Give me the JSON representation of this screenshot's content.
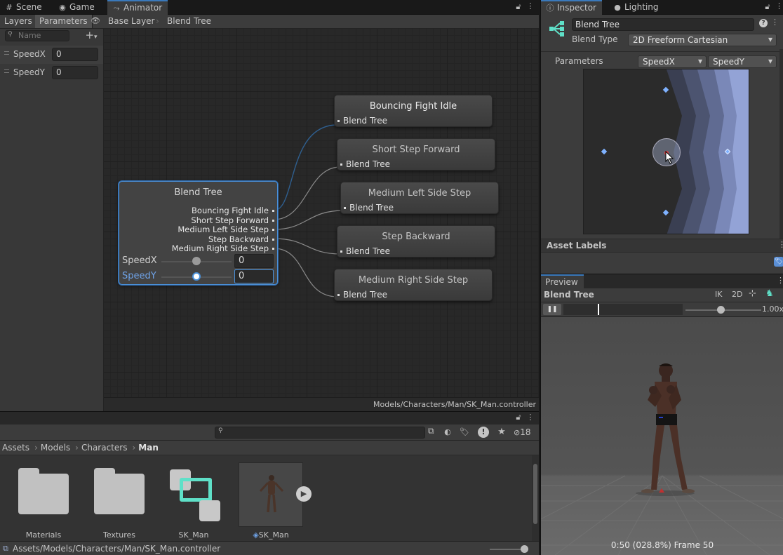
{
  "animator_window": {
    "tabs": [
      {
        "label": "Scene",
        "icon": "hash-icon"
      },
      {
        "label": "Game",
        "icon": "gamepad-icon"
      },
      {
        "label": "Animator",
        "icon": "animator-icon"
      }
    ],
    "subtabs": {
      "layers": "Layers",
      "parameters": "Parameters"
    },
    "search_placeholder": "Name",
    "breadcrumb": [
      "Base Layer",
      "Blend Tree"
    ],
    "parameters": [
      {
        "name": "SpeedX",
        "value": "0"
      },
      {
        "name": "SpeedY",
        "value": "0"
      }
    ],
    "status_path": "Models/Characters/Man/SK_Man.controller"
  },
  "blend_tree_node": {
    "title": "Blend Tree",
    "outputs": [
      "Bouncing Fight Idle",
      "Short Step Forward",
      "Medium Left Side Step",
      "Step Backward",
      "Medium Right Side Step"
    ],
    "sliders": [
      {
        "label": "SpeedX",
        "value": "0"
      },
      {
        "label": "SpeedY",
        "value": "0"
      }
    ]
  },
  "motion_nodes": [
    {
      "title": "Bouncing Fight Idle",
      "port": "Blend Tree"
    },
    {
      "title": "Short Step Forward",
      "port": "Blend Tree"
    },
    {
      "title": "Medium Left Side Step",
      "port": "Blend Tree"
    },
    {
      "title": "Step Backward",
      "port": "Blend Tree"
    },
    {
      "title": "Medium Right Side Step",
      "port": "Blend Tree"
    }
  ],
  "project_window": {
    "breadcrumb": [
      "Assets",
      "Models",
      "Characters",
      "Man"
    ],
    "hidden_count": "18",
    "assets": [
      {
        "name": "Materials",
        "type": "folder"
      },
      {
        "name": "Textures",
        "type": "folder"
      },
      {
        "name": "SK_Man",
        "type": "animator-controller"
      },
      {
        "name": "SK_Man",
        "type": "model"
      }
    ],
    "status_path": "Assets/Models/Characters/Man/SK_Man.controller"
  },
  "inspector": {
    "tabs": [
      {
        "label": "Inspector",
        "icon": "info-icon"
      },
      {
        "label": "Lighting",
        "icon": "bulb-icon"
      }
    ],
    "name": "Blend Tree",
    "blend_type_label": "Blend Type",
    "blend_type": "2D Freeform Cartesian",
    "parameters_label": "Parameters",
    "param_x": "SpeedX",
    "param_y": "SpeedY",
    "asset_labels": "Asset Labels"
  },
  "preview": {
    "tab": "Preview",
    "title": "Blend Tree",
    "buttons": {
      "ik": "IK",
      "twod": "2D"
    },
    "speed": "1.00x",
    "footer": "0:50 (028.8%) Frame 50"
  },
  "colors": {
    "accent": "#4a90d9",
    "selection": "#3a79bb"
  }
}
